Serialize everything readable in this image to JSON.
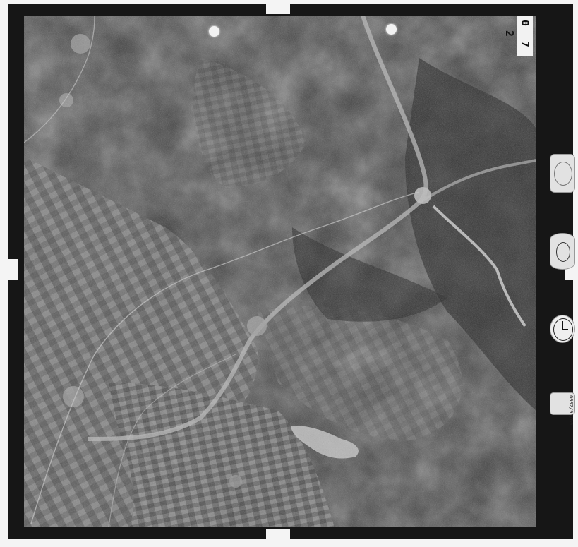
{
  "photo": {
    "frame_number": "0 7 2",
    "type": "black-and-white aerial survey photograph"
  },
  "colors": {
    "frame": "#161616",
    "terrain_dark": "#3a3a3a",
    "fields_light": "#8a8a8a",
    "river": "#cfcfcf"
  },
  "data_strip": {
    "counter_text": "0002/95/69"
  }
}
